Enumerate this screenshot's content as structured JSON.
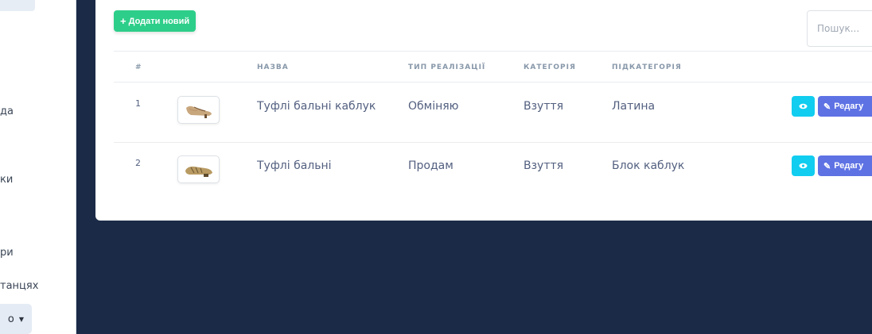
{
  "sidebar": {
    "items": [
      {
        "label": "да"
      },
      {
        "label": "ки"
      },
      {
        "label": "ри"
      },
      {
        "label": "танцях"
      }
    ],
    "dropdown_label": "о"
  },
  "toolbar": {
    "add_label": "Додати новий",
    "search_placeholder": "Пошук..."
  },
  "table": {
    "headers": [
      "#",
      "",
      "НАЗВА",
      "ТИП РЕАЛІЗАЦІЇ",
      "КАТЕГОРІЯ",
      "ПІДКАТЕГОРІЯ"
    ],
    "rows": [
      {
        "num": "1",
        "name": "Туфлі бальні каблук",
        "sale_type": "Обміняю",
        "category": "Взуття",
        "subcategory": "Латина"
      },
      {
        "num": "2",
        "name": "Туфлі бальні",
        "sale_type": "Продам",
        "category": "Взуття",
        "subcategory": "Блок каблук"
      }
    ],
    "edit_label": "Редагу"
  },
  "colors": {
    "add": "#2dce89",
    "view": "#11cdef",
    "edit": "#5e72e4",
    "background": "#1b2a47"
  }
}
